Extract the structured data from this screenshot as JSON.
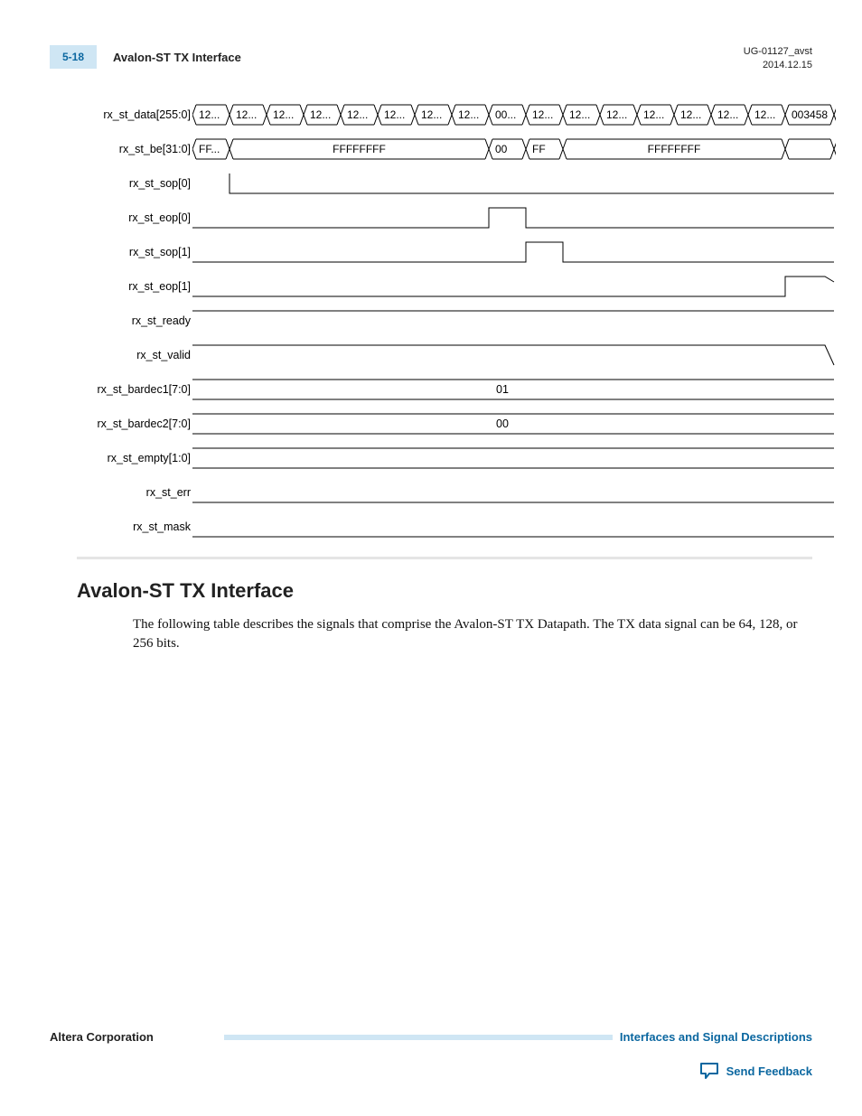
{
  "header": {
    "page_num": "5-18",
    "title": "Avalon-ST TX Interface",
    "doc_id": "UG-01127_avst",
    "date": "2014.12.15"
  },
  "timing": {
    "rows": [
      {
        "label": "rx_st_data[255:0]",
        "type": "bus",
        "cells": [
          "12...",
          "12...",
          "12...",
          "12...",
          "12...",
          "12...",
          "12...",
          "12...",
          "00...",
          "12...",
          "12...",
          "12...",
          "12...",
          "12...",
          "12...",
          "12...",
          "003458"
        ],
        "boundaries": [
          0,
          41,
          82,
          123,
          164,
          205,
          246,
          287,
          328,
          369,
          410,
          451,
          492,
          533,
          574,
          615,
          656,
          710
        ]
      },
      {
        "label": "rx_st_be[31:0]",
        "type": "bus",
        "cells": [
          "FF...",
          "FFFFFFFF",
          "00",
          "FF",
          "FFFFFFFF",
          ""
        ],
        "boundaries": [
          0,
          41,
          328,
          369,
          410,
          656,
          710
        ]
      },
      {
        "label": "rx_st_sop[0]",
        "type": "pulse_rect",
        "start": 41,
        "end": 710,
        "pulse_from": null,
        "pulse_to": null,
        "open_left": true
      },
      {
        "label": "rx_st_eop[0]",
        "type": "pulse_rect",
        "start": 0,
        "end": 710,
        "pulse_from": 328,
        "pulse_to": 369
      },
      {
        "label": "rx_st_sop[1]",
        "type": "pulse_rect",
        "start": 0,
        "end": 710,
        "pulse_from": 369,
        "pulse_to": 410
      },
      {
        "label": "rx_st_eop[1]",
        "type": "pulse_rect",
        "start": 0,
        "end": 710,
        "pulse_from": 656,
        "pulse_to": 700,
        "open_right": true
      },
      {
        "label": "rx_st_ready",
        "type": "high_line",
        "start": 0,
        "end": 710
      },
      {
        "label": "rx_st_valid",
        "type": "high_drop",
        "start": 0,
        "end": 710,
        "drop_at": 700
      },
      {
        "label": "rx_st_bardec1[7:0]",
        "type": "single_bus",
        "value": "01",
        "start": 0,
        "end": 710
      },
      {
        "label": "rx_st_bardec2[7:0]",
        "type": "single_bus",
        "value": "00",
        "start": 0,
        "end": 710
      },
      {
        "label": "rx_st_empty[1:0]",
        "type": "single_bus",
        "value": "",
        "start": 0,
        "end": 710
      },
      {
        "label": "rx_st_err",
        "type": "low_line",
        "start": 0,
        "end": 710
      },
      {
        "label": "rx_st_mask",
        "type": "low_line",
        "start": 0,
        "end": 710
      }
    ]
  },
  "section": {
    "heading": "Avalon-ST TX Interface",
    "paragraph": "The following table describes the signals that comprise the Avalon-ST TX Datapath. The TX data signal can be 64, 128, or 256 bits."
  },
  "footer": {
    "corp": "Altera Corporation",
    "link": "Interfaces and Signal Descriptions",
    "feedback": "Send Feedback"
  }
}
